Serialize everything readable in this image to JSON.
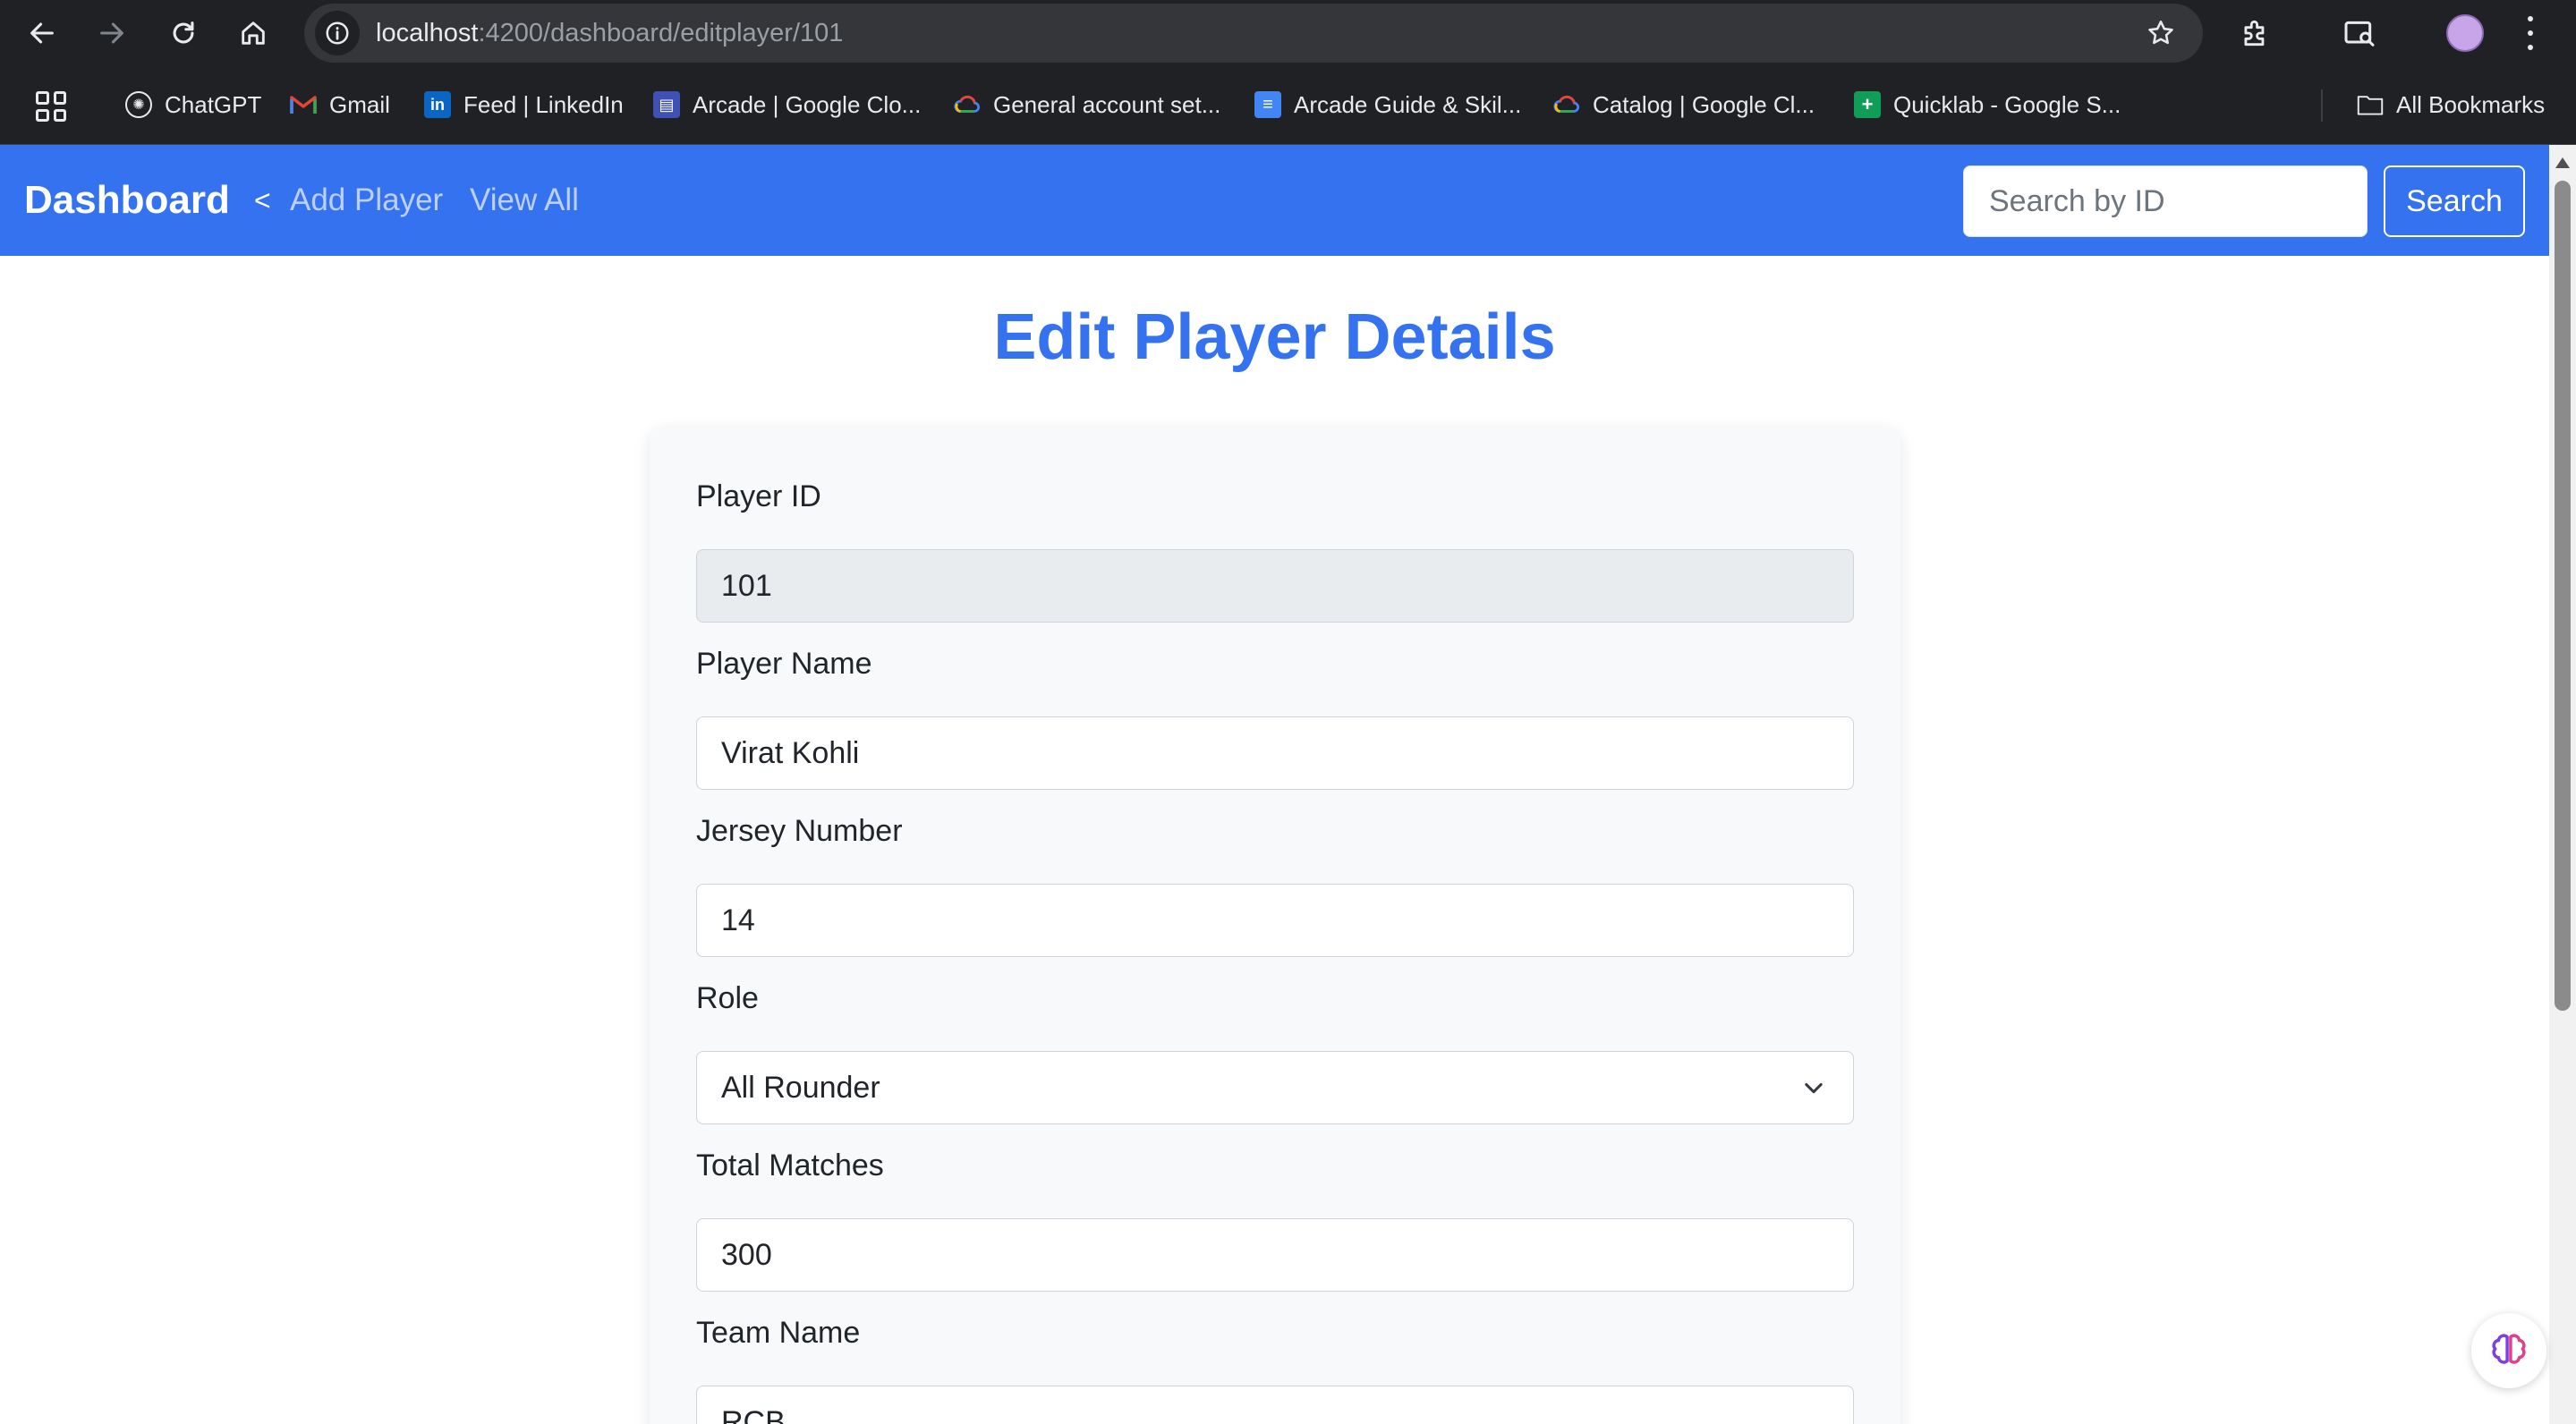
{
  "browser": {
    "url_host": "localhost",
    "url_path": ":4200/dashboard/editplayer/101",
    "bookmarks": [
      {
        "label": "ChatGPT",
        "icon": "chatgpt-icon"
      },
      {
        "label": "Gmail",
        "icon": "gmail-icon"
      },
      {
        "label": "Feed | LinkedIn",
        "icon": "linkedin-icon"
      },
      {
        "label": "Arcade | Google Clo...",
        "icon": "arcade-icon"
      },
      {
        "label": "General account set...",
        "icon": "google-cloud-icon"
      },
      {
        "label": "Arcade Guide & Skil...",
        "icon": "docs-icon"
      },
      {
        "label": "Catalog | Google Cl...",
        "icon": "google-cloud-icon"
      },
      {
        "label": "Quicklab - Google S...",
        "icon": "sheets-icon"
      }
    ],
    "all_bookmarks": "All Bookmarks"
  },
  "navbar": {
    "brand": "Dashboard",
    "chevron": "<",
    "links": [
      "Add Player",
      "View All"
    ],
    "search_placeholder": "Search by ID",
    "search_button": "Search",
    "color": "#3572f0"
  },
  "page": {
    "title": "Edit Player Details"
  },
  "form": {
    "player_id": {
      "label": "Player ID",
      "value": "101"
    },
    "player_name": {
      "label": "Player Name",
      "value": "Virat Kohli"
    },
    "jersey_number": {
      "label": "Jersey Number",
      "value": "14"
    },
    "role": {
      "label": "Role",
      "value": "All Rounder"
    },
    "total_matches": {
      "label": "Total Matches",
      "value": "300"
    },
    "team_name": {
      "label": "Team Name",
      "value": "RCB"
    }
  }
}
